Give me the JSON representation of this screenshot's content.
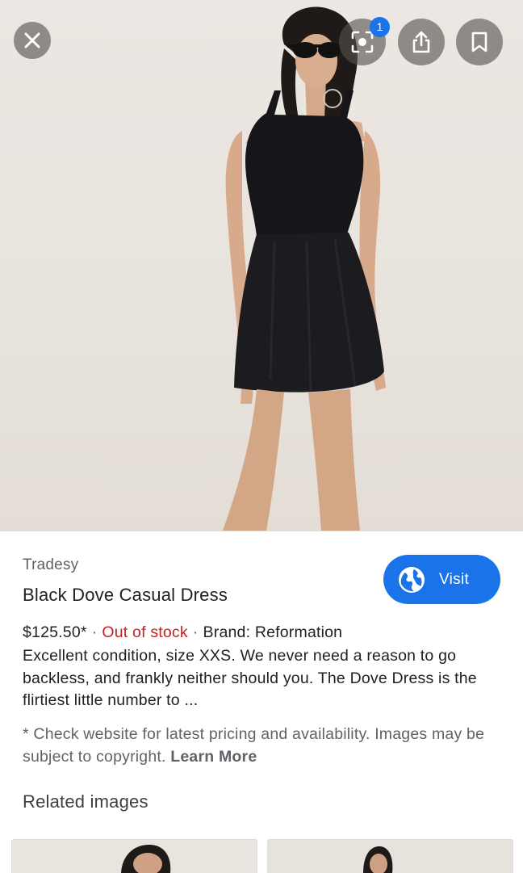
{
  "hero": {
    "alt": "Woman in black halter mini dress"
  },
  "toolbar": {
    "close_icon": "close-icon",
    "lens_icon": "lens-icon",
    "lens_badge": "1",
    "share_icon": "share-icon",
    "save_icon": "bookmark-icon"
  },
  "product": {
    "source": "Tradesy",
    "title": "Black Dove Casual Dress",
    "price": "$125.50*",
    "separator": "·",
    "stock_status": "Out of stock",
    "brand": "Brand: Reformation",
    "description": "Excellent condition, size XXS. We never need a reason to go backless, and frankly neither should you. The Dove Dress is the flirtiest little number to ...",
    "disclaimer": "* Check website for latest pricing and availability. Images may be subject to copyright.",
    "learn_more": "Learn More"
  },
  "visit_button": {
    "label": "Visit",
    "icon": "globe-icon"
  },
  "related": {
    "title": "Related images"
  },
  "colors": {
    "accent": "#1a73e8",
    "stock_red": "#c5221f",
    "secondary_text": "#5f6368",
    "primary_text": "#202124"
  }
}
